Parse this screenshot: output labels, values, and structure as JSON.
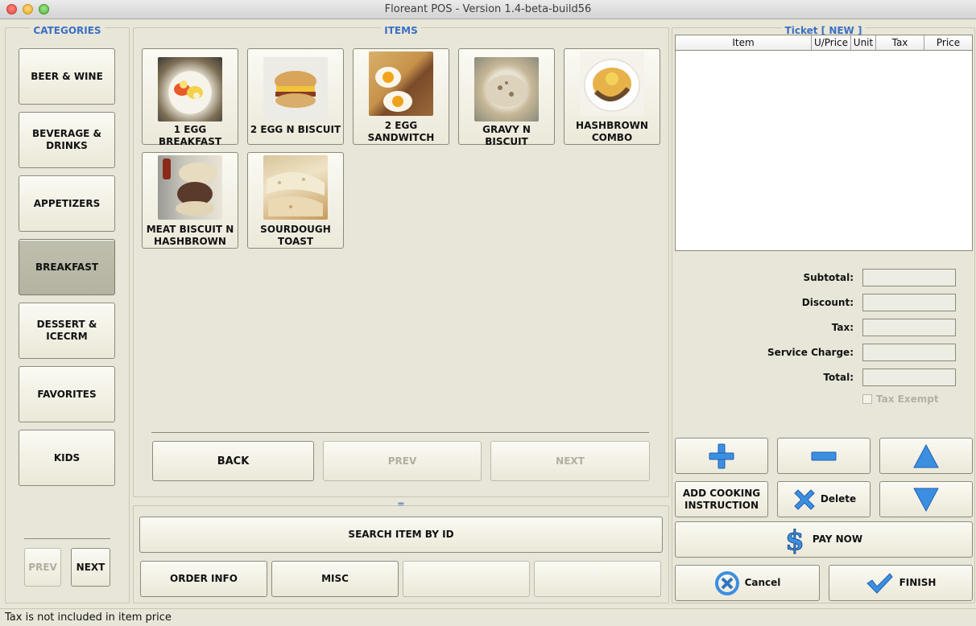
{
  "window": {
    "title": "Floreant POS - Version 1.4-beta-build56"
  },
  "categories": {
    "legend": "CATEGORIES",
    "items": [
      "BEER & WINE",
      "BEVERAGE & DRINKS",
      "APPETIZERS",
      "BREAKFAST",
      "DESSERT & ICECRM",
      "FAVORITES",
      "KIDS"
    ],
    "selected": "BREAKFAST",
    "prev_label": "PREV",
    "next_label": "NEXT"
  },
  "items_panel": {
    "legend": "ITEMS",
    "items": [
      "1 EGG BREAKFAST",
      "2 EGG N BISCUIT",
      "2 EGG SANDWITCH",
      "GRAVY N BISCUIT",
      "HASHBROWN COMBO",
      "MEAT BISCUIT N HASHBROWN",
      "SOURDOUGH TOAST"
    ],
    "back_label": "BACK",
    "prev_label": "PREV",
    "next_label": "NEXT"
  },
  "bottom": {
    "divider": "=",
    "search_label": "SEARCH ITEM BY ID",
    "order_info_label": "ORDER INFO",
    "misc_label": "MISC"
  },
  "ticket": {
    "legend": "Ticket [ NEW ]",
    "columns": [
      "Item",
      "U/Price",
      "Unit",
      "Tax",
      "Price"
    ],
    "subtotal_label": "Subtotal:",
    "discount_label": "Discount:",
    "tax_label": "Tax:",
    "service_charge_label": "Service Charge:",
    "total_label": "Total:",
    "tax_exempt_label": "Tax Exempt",
    "add_cooking_label": "ADD COOKING INSTRUCTION",
    "delete_label": "Delete",
    "pay_now_label": "PAY NOW",
    "cancel_label": "Cancel",
    "finish_label": "FINISH"
  },
  "status": {
    "text": "Tax is not included in item price"
  },
  "colors": {
    "accent": "#3a6fc4",
    "selected_category": "#bab9a8",
    "background": "#e8e6d8"
  },
  "icons": [
    "plus-icon",
    "minus-icon",
    "up-arrow-icon",
    "down-arrow-icon",
    "delete-x-icon",
    "dollar-icon",
    "cancel-icon",
    "checkmark-icon"
  ]
}
